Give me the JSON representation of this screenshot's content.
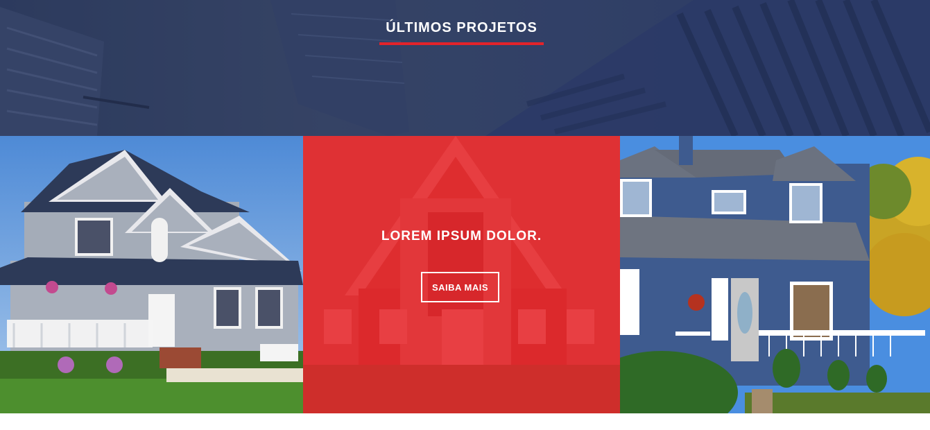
{
  "section": {
    "title": "ÚLTIMOS PROJETOS"
  },
  "projects": {
    "featured": {
      "heading": "LOREM IPSUM DOLOR.",
      "button_label": "SAIBA MAIS"
    }
  },
  "colors": {
    "accent": "#e3232a",
    "hero_overlay": "#2e3d60",
    "white": "#ffffff"
  }
}
